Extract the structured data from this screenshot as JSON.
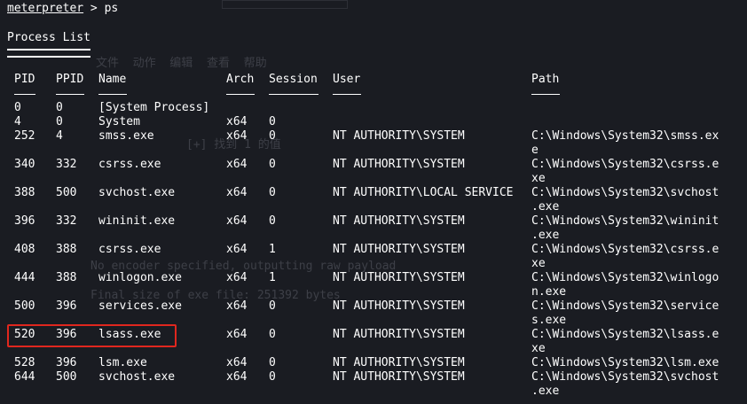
{
  "prompt": {
    "word": "meterpreter",
    "rest": " > ps"
  },
  "title": "Process List",
  "headers": {
    "pid": "PID",
    "ppid": "PPID",
    "name": "Name",
    "arch": "Arch",
    "session": "Session",
    "user": "User",
    "path": "Path"
  },
  "rows": [
    {
      "pid": "0",
      "ppid": "0",
      "name": "[System Process]",
      "arch": "",
      "session": "",
      "user": "",
      "path": [
        "",
        ""
      ]
    },
    {
      "pid": "4",
      "ppid": "0",
      "name": "System",
      "arch": "x64",
      "session": "0",
      "user": "",
      "path": [
        "",
        ""
      ]
    },
    {
      "pid": "252",
      "ppid": "4",
      "name": "smss.exe",
      "arch": "x64",
      "session": "0",
      "user": "NT AUTHORITY\\SYSTEM",
      "path": [
        "C:\\Windows\\System32\\smss.ex",
        "e"
      ]
    },
    {
      "pid": "340",
      "ppid": "332",
      "name": "csrss.exe",
      "arch": "x64",
      "session": "0",
      "user": "NT AUTHORITY\\SYSTEM",
      "path": [
        "C:\\Windows\\System32\\csrss.e",
        "xe"
      ]
    },
    {
      "pid": "388",
      "ppid": "500",
      "name": "svchost.exe",
      "arch": "x64",
      "session": "0",
      "user": "NT AUTHORITY\\LOCAL SERVICE",
      "path": [
        "C:\\Windows\\System32\\svchost",
        ".exe"
      ]
    },
    {
      "pid": "396",
      "ppid": "332",
      "name": "wininit.exe",
      "arch": "x64",
      "session": "0",
      "user": "NT AUTHORITY\\SYSTEM",
      "path": [
        "C:\\Windows\\System32\\wininit",
        ".exe"
      ]
    },
    {
      "pid": "408",
      "ppid": "388",
      "name": "csrss.exe",
      "arch": "x64",
      "session": "1",
      "user": "NT AUTHORITY\\SYSTEM",
      "path": [
        "C:\\Windows\\System32\\csrss.e",
        "xe"
      ]
    },
    {
      "pid": "444",
      "ppid": "388",
      "name": "winlogon.exe",
      "arch": "x64",
      "session": "1",
      "user": "NT AUTHORITY\\SYSTEM",
      "path": [
        "C:\\Windows\\System32\\winlogo",
        "n.exe"
      ]
    },
    {
      "pid": "500",
      "ppid": "396",
      "name": "services.exe",
      "arch": "x64",
      "session": "0",
      "user": "NT AUTHORITY\\SYSTEM",
      "path": [
        "C:\\Windows\\System32\\service",
        "s.exe"
      ]
    },
    {
      "pid": "520",
      "ppid": "396",
      "name": "lsass.exe",
      "arch": "x64",
      "session": "0",
      "user": "NT AUTHORITY\\SYSTEM",
      "path": [
        "C:\\Windows\\System32\\lsass.e",
        "xe"
      ]
    },
    {
      "pid": "528",
      "ppid": "396",
      "name": "lsm.exe",
      "arch": "x64",
      "session": "0",
      "user": "NT AUTHORITY\\SYSTEM",
      "path": [
        "C:\\Windows\\System32\\lsm.exe",
        ""
      ]
    },
    {
      "pid": "644",
      "ppid": "500",
      "name": "svchost.exe",
      "arch": "x64",
      "session": "0",
      "user": "NT AUTHORITY\\SYSTEM",
      "path": [
        "C:\\Windows\\System32\\svchost",
        ".exe"
      ]
    }
  ],
  "highlight_pid": "520",
  "ghost_text": {
    "menu": "文件  动作  编辑  查看  帮助",
    "l1": "[+] 找到 1 的值",
    "l2": "No encoder specified, outputting raw payload",
    "l3": "Final size of exe file: 251392 bytes"
  },
  "colors": {
    "background": "#1a1c22",
    "text": "#ffffff",
    "highlight": "#e0271e"
  }
}
